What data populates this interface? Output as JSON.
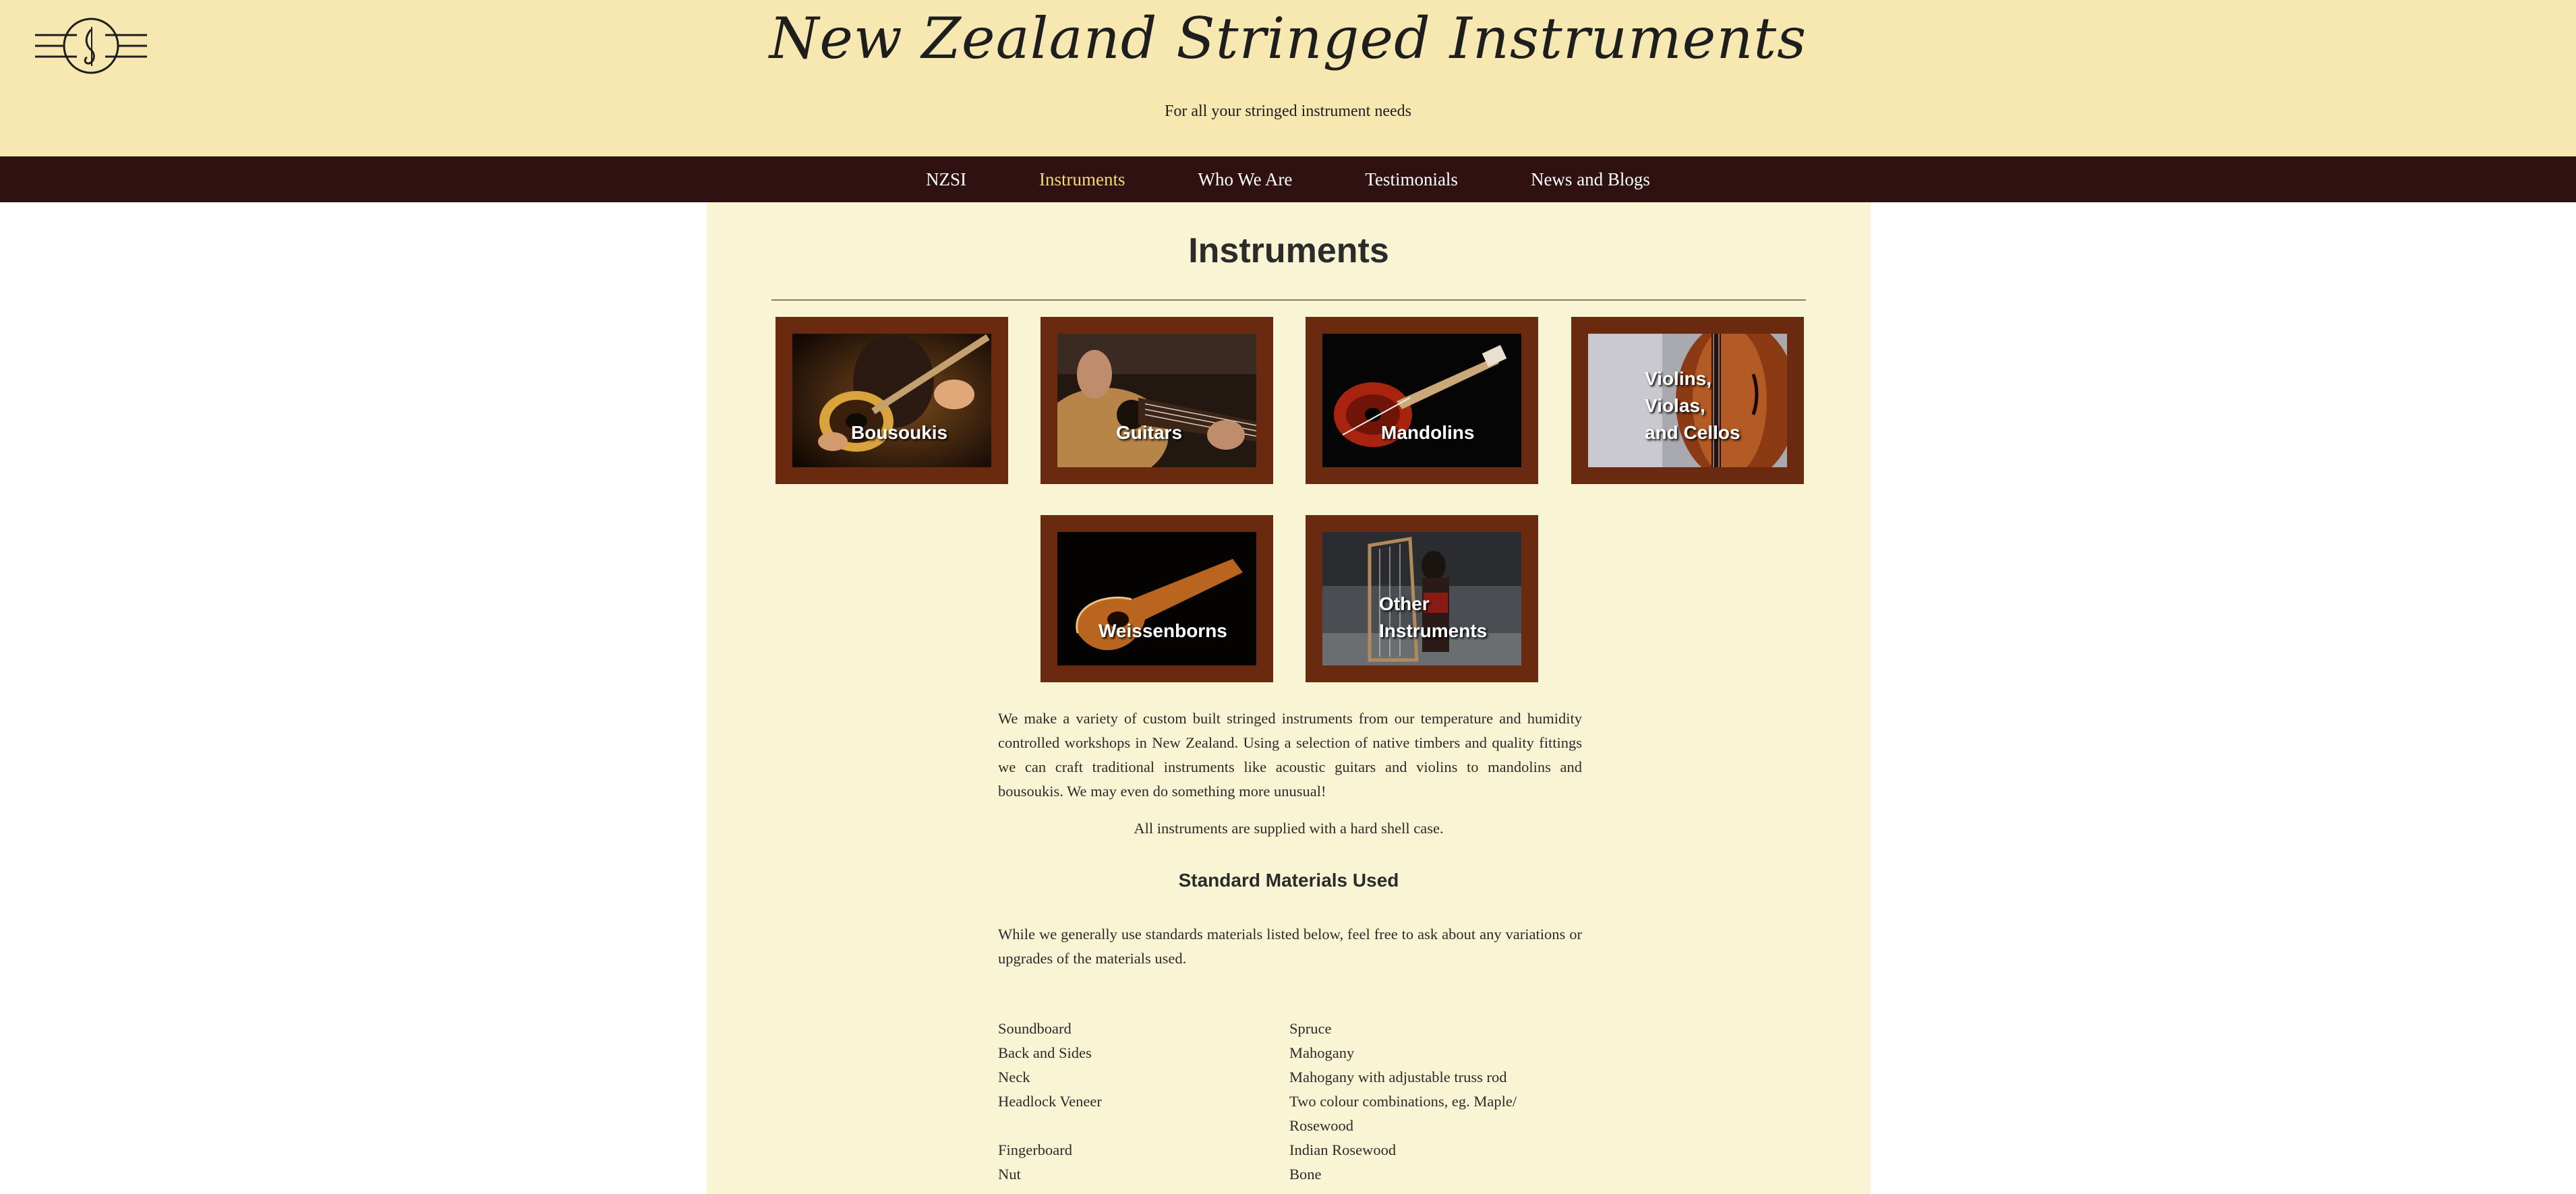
{
  "header": {
    "site_title": "New Zealand Stringed Instruments",
    "tagline": "For all your stringed instrument needs"
  },
  "nav": {
    "items": [
      {
        "label": "NZSI"
      },
      {
        "label": "Instruments",
        "active": true
      },
      {
        "label": "Who We Are"
      },
      {
        "label": "Testimonials"
      },
      {
        "label": "News and Blogs"
      }
    ]
  },
  "main": {
    "title": "Instruments",
    "tiles": [
      {
        "lines": [
          "Bousoukis"
        ]
      },
      {
        "lines": [
          "Guitars"
        ]
      },
      {
        "lines": [
          "Mandolins"
        ]
      },
      {
        "lines": [
          "Violins,",
          "Violas,",
          "and Cellos"
        ]
      },
      {
        "lines": [
          "Weissenborns"
        ]
      },
      {
        "lines": [
          "Other",
          "Instruments"
        ]
      }
    ],
    "intro": "We make a variety of custom built stringed instruments from our temperature and humidity controlled workshops in New Zealand. Using a selection of native timbers and quality fittings we can craft traditional instruments like acoustic guitars and violins to mandolins and bousoukis. We may even do something more unusual!",
    "case_note": "All instruments are supplied with a hard shell case.",
    "materials_heading": "Standard Materials Used",
    "materials_intro": "While we generally use standards materials listed below, feel free to ask about any variations or upgrades of the materials used.",
    "materials": [
      {
        "part": "Soundboard",
        "material": "Spruce"
      },
      {
        "part": "Back and Sides",
        "material": "Mahogany"
      },
      {
        "part": "Neck",
        "material": "Mahogany with adjustable truss rod"
      },
      {
        "part": "Headlock Veneer",
        "material": "Two colour combinations, eg. Maple/ Rosewood"
      },
      {
        "part": "Fingerboard",
        "material": "Indian Rosewood"
      },
      {
        "part": "Nut",
        "material": "Bone"
      }
    ]
  },
  "colors": {
    "header_bg": "#f6e8b0",
    "nav_bg": "#2f1111",
    "nav_active": "#f2dc78",
    "panel_bg": "#f9f4d3",
    "tile_frame": "#6a2a10"
  }
}
